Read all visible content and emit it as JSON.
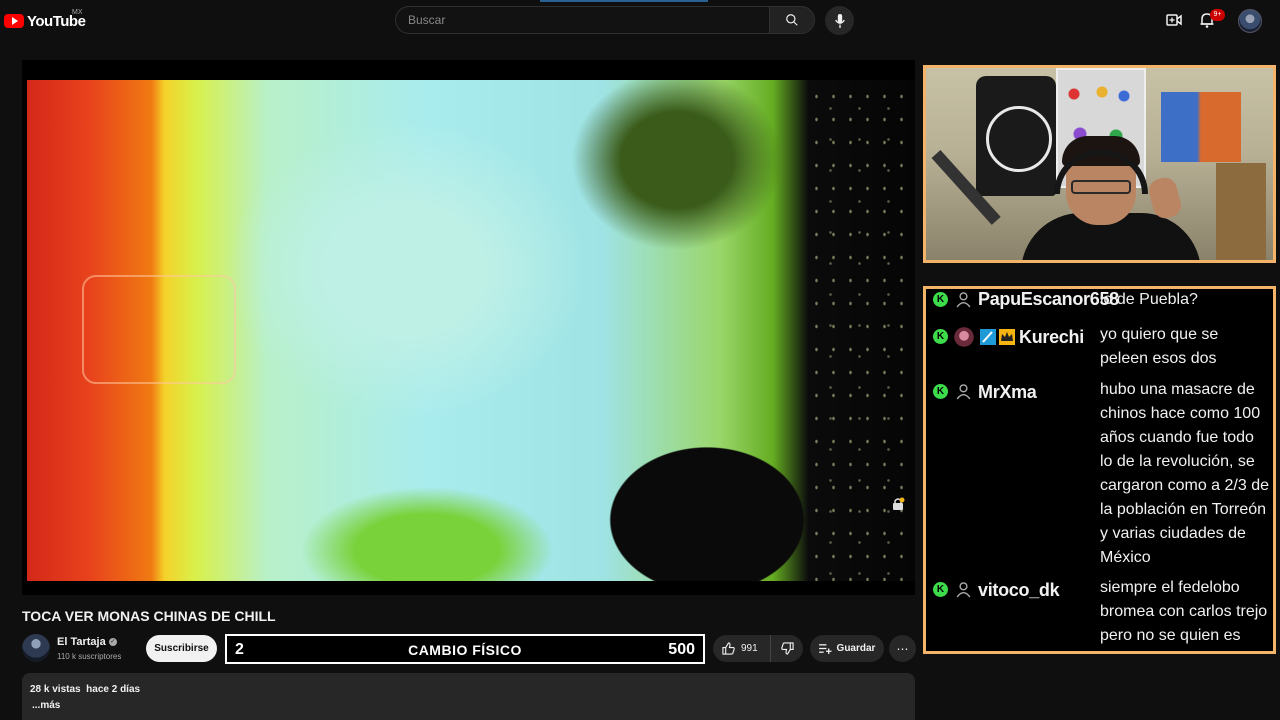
{
  "header": {
    "logo_text": "YouTube",
    "region": "MX",
    "search_placeholder": "Buscar",
    "notification_count": "9+"
  },
  "video": {
    "title": "TOCA VER MONAS CHINAS DE CHILL"
  },
  "channel": {
    "name": "El Tartaja",
    "verified_mark": "✓",
    "subscribers": "110 k suscriptores",
    "subscribe_label": "Suscribirse"
  },
  "banner": {
    "left_number": "2",
    "title": "CAMBIO FÍSICO",
    "right_number": "500"
  },
  "actions": {
    "like_count": "991",
    "save_label": "Guardar",
    "more_label": "⋯"
  },
  "description": {
    "meta": "28 k vistas  hace 2 días",
    "more": "...más"
  },
  "chat": {
    "badge_label": "K",
    "messages": [
      {
        "name": "PapuEscanor658",
        "text": "lo de Puebla?"
      },
      {
        "name": "Kurechi",
        "text": "yo quiero que se peleen esos dos"
      },
      {
        "name": "MrXma",
        "text": "hubo una masacre de chinos hace como 100 años cuando fue todo lo de la revolución, se cargaron como a 2/3 de la población en Torreón y varias ciudades de México"
      },
      {
        "name": "vitoco_dk",
        "text": "siempre el fedelobo bromea con carlos trejo pero no se quien es"
      }
    ]
  },
  "colors": {
    "accent_border": "#f3b46a",
    "chat_badge": "#3ddc4a",
    "youtube_red": "#ff0000"
  }
}
